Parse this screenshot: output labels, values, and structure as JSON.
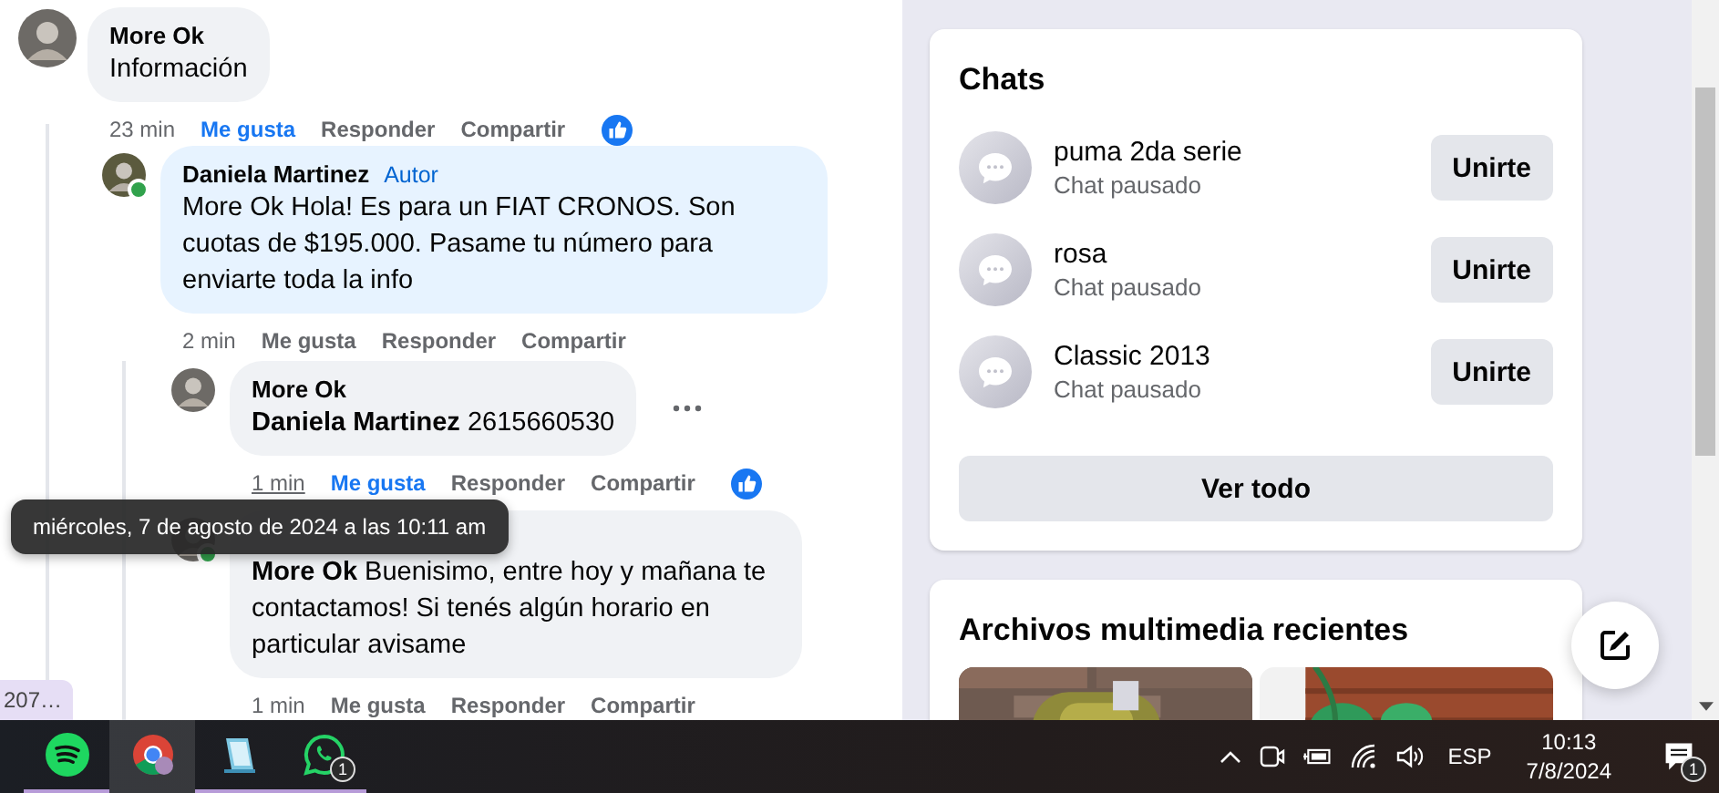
{
  "thread": [
    {
      "author": "More Ok",
      "text": "Información",
      "time": "23 min",
      "hovered": false,
      "actions": [
        "Me gusta",
        "Responder",
        "Compartir"
      ],
      "liked": true,
      "reaction": true,
      "children": [
        {
          "author": "Daniela Martinez",
          "badge": "Autor",
          "text": "More Ok Hola! Es para un FIAT CRONOS. Son cuotas de $195.000. Pasame tu número para enviarte toda la info",
          "time": "2 min",
          "hovered": false,
          "actions": [
            "Me gusta",
            "Responder",
            "Compartir"
          ],
          "liked": false,
          "highlighted": true,
          "online": true,
          "children": [
            {
              "author": "More Ok",
              "text": "**Daniela Martinez** 2615660530",
              "time": "1 min",
              "hovered": true,
              "actions": [
                "Me gusta",
                "Responder",
                "Compartir"
              ],
              "liked": true,
              "reaction": true,
              "menu": true
            },
            {
              "text": "**More Ok** Buenisimo, entre hoy y mañana te contactamos! Si tenés algún horario en particular avisame",
              "time": "1 min",
              "hovered": false,
              "actions": [
                "Me gusta",
                "Responder",
                "Compartir"
              ],
              "liked": false,
              "online": true
            }
          ]
        }
      ]
    }
  ],
  "tooltip": {
    "text": "miércoles, 7 de agosto de 2024 a las 10:11 am"
  },
  "tag": {
    "text": "207…"
  },
  "chats": {
    "title": "Chats",
    "items": [
      {
        "name": "puma 2da serie",
        "status": "Chat pausado",
        "button": "Unirte"
      },
      {
        "name": "rosa",
        "status": "Chat pausado",
        "button": "Unirte"
      },
      {
        "name": "Classic 2013",
        "status": "Chat pausado",
        "button": "Unirte"
      }
    ],
    "see_all": "Ver todo"
  },
  "media": {
    "title": "Archivos multimedia recientes"
  },
  "taskbar": {
    "apps": [
      {
        "kind": "music",
        "running": true,
        "selected": false
      },
      {
        "kind": "browser",
        "running": false,
        "selected": true
      },
      {
        "kind": "notes",
        "running": true,
        "selected": false
      },
      {
        "kind": "messenger",
        "running": true,
        "selected": false,
        "badge": "1"
      }
    ],
    "language": "ESP",
    "time": "10:13",
    "date": "7/8/2024",
    "notification_badge": "1"
  }
}
